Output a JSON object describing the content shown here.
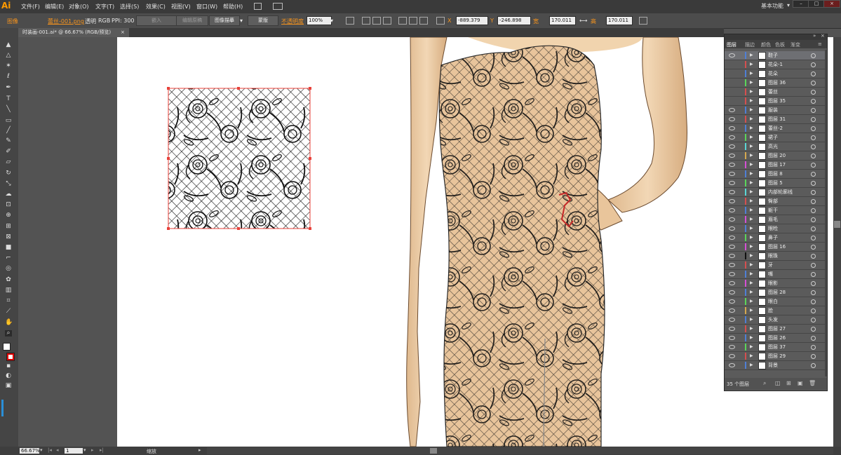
{
  "app": {
    "logo": "Ai",
    "workspace": "基本功能"
  },
  "menu": [
    "文件(F)",
    "编辑(E)",
    "对象(O)",
    "文字(T)",
    "选择(S)",
    "效果(C)",
    "视图(V)",
    "窗口(W)",
    "帮助(H)"
  ],
  "control_bar": {
    "object_type": "图像",
    "file_name": "蕾丝-001.png",
    "transparency_label": "透明",
    "color_mode": "RGB",
    "ppi": "PPI: 300",
    "embed_button": "嵌入",
    "edit_original_button": "编辑原稿",
    "image_trace_button": "图像描摹",
    "mask_button": "蒙版",
    "opacity_label": "不透明度",
    "opacity_value": "100%",
    "x_label": "X",
    "x_value": "-889.379",
    "y_label": "Y",
    "y_value": "-246.898",
    "width_label": "宽",
    "width_value": "170.011",
    "height_label": "高",
    "height_value": "170.011"
  },
  "document_tab": {
    "title": "时装画-001.ai* @ 66.67% (RGB/预览)",
    "close": "×"
  },
  "layers_panel": {
    "tabs": [
      "图层",
      "描边",
      "颜色",
      "色板",
      "渐变"
    ],
    "active_tab": "图层",
    "layers": [
      {
        "name": "鞋子",
        "color": "#4f7fd6",
        "visible": true,
        "selected": true
      },
      {
        "name": "花朵-1",
        "color": "#d64f4f",
        "visible": false
      },
      {
        "name": "花朵",
        "color": "#4f7fd6",
        "visible": false
      },
      {
        "name": "图层 36",
        "color": "#5ad65a",
        "visible": false
      },
      {
        "name": "蕾丝",
        "color": "#d64f4f",
        "visible": false
      },
      {
        "name": "图层 35",
        "color": "#d64f4f",
        "visible": false
      },
      {
        "name": "服装",
        "color": "#4f7fd6",
        "visible": true
      },
      {
        "name": "图层 31",
        "color": "#d64f4f",
        "visible": true
      },
      {
        "name": "蕾丝-2",
        "color": "#4f7fd6",
        "visible": true
      },
      {
        "name": "裙子",
        "color": "#5ad65a",
        "visible": true
      },
      {
        "name": "高光",
        "color": "#5ad6d6",
        "visible": true
      },
      {
        "name": "图层 20",
        "color": "#d6a84f",
        "visible": true
      },
      {
        "name": "图层 17",
        "color": "#d64fd6",
        "visible": true
      },
      {
        "name": "图层 8",
        "color": "#4f7fd6",
        "visible": true
      },
      {
        "name": "图层 5",
        "color": "#5ad65a",
        "visible": true
      },
      {
        "name": "内部轮廓线",
        "color": "#5ad6d6",
        "visible": true
      },
      {
        "name": "臀部",
        "color": "#d64f4f",
        "visible": true
      },
      {
        "name": "躯干",
        "color": "#4f7fd6",
        "visible": true
      },
      {
        "name": "眉毛",
        "color": "#d64fd6",
        "visible": true
      },
      {
        "name": "眼睑",
        "color": "#4f7fd6",
        "visible": true
      },
      {
        "name": "鼻子",
        "color": "#5ad65a",
        "visible": true
      },
      {
        "name": "图层 16",
        "color": "#d64fd6",
        "visible": true
      },
      {
        "name": "眼珠",
        "color": "#111111",
        "visible": true
      },
      {
        "name": "牙",
        "color": "#d64f4f",
        "visible": true
      },
      {
        "name": "嘴",
        "color": "#4f7fd6",
        "visible": true
      },
      {
        "name": "眼影",
        "color": "#d64fd6",
        "visible": true
      },
      {
        "name": "图层 28",
        "color": "#4f7fd6",
        "visible": true
      },
      {
        "name": "眼白",
        "color": "#5ad65a",
        "visible": true
      },
      {
        "name": "脸",
        "color": "#d6a84f",
        "visible": true
      },
      {
        "name": "头发",
        "color": "#4f7fd6",
        "visible": true
      },
      {
        "name": "图层 27",
        "color": "#d64f4f",
        "visible": true
      },
      {
        "name": "图层 26",
        "color": "#4f7fd6",
        "visible": true
      },
      {
        "name": "图层 37",
        "color": "#5ad65a",
        "visible": true
      },
      {
        "name": "图层 29",
        "color": "#d64f4f",
        "visible": true
      },
      {
        "name": "背景",
        "color": "#4f7fd6",
        "visible": true
      }
    ],
    "footer_count": "35 个图层"
  },
  "status_bar": {
    "zoom": "66.67%",
    "artboard_number": "1",
    "tool_name": "缩放"
  },
  "colors": {
    "accent": "#f7941d",
    "selection": "#e8413a",
    "skin": "#e8c49b"
  }
}
